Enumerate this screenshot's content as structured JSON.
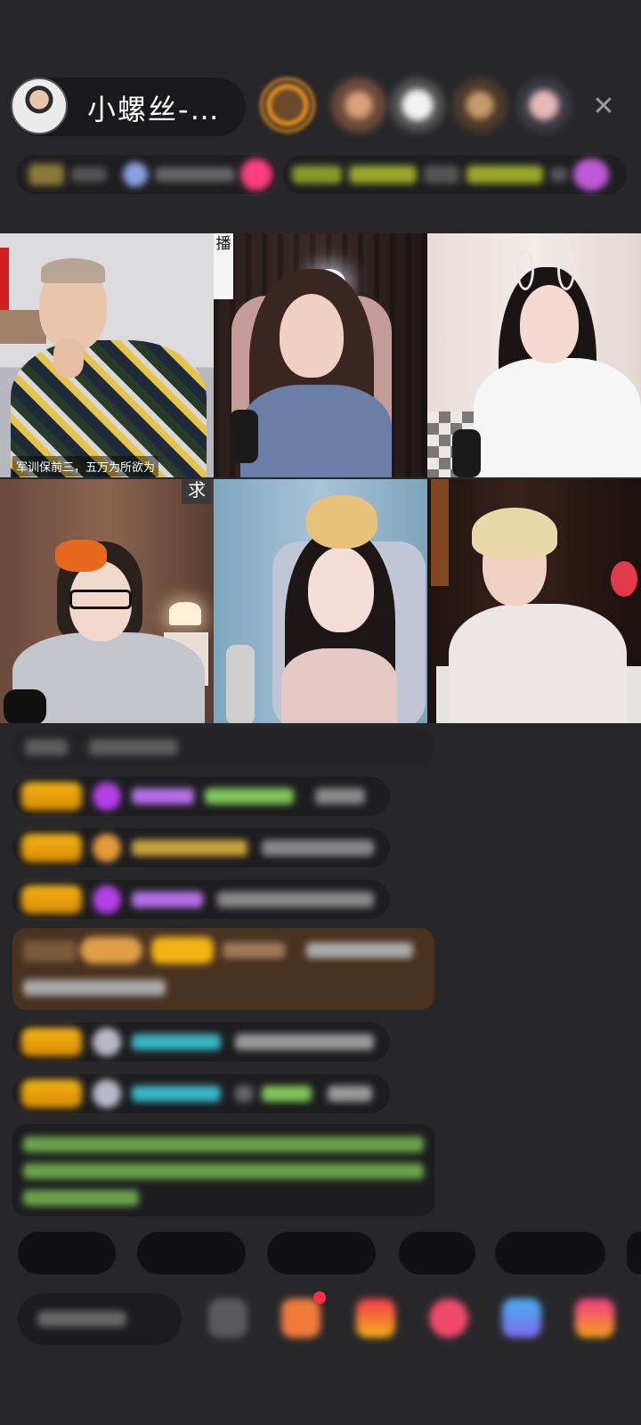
{
  "host": {
    "name": "小螺丝-…"
  },
  "header": {
    "close_icon": "close-icon",
    "viewer_count": 5
  },
  "streams": [
    {
      "overlay_text": "军训保前三，五万为所欲为",
      "corner_tag": "播"
    },
    {
      "overlay_text": "",
      "corner_tag": ""
    },
    {
      "overlay_text": "",
      "corner_tag": ""
    },
    {
      "overlay_text": "",
      "corner_tag": "求"
    },
    {
      "overlay_text": "",
      "corner_tag": ""
    },
    {
      "overlay_text": "",
      "corner_tag": ""
    }
  ],
  "colors": {
    "background": "#27272a",
    "badge": "#f3b413",
    "accent_pink": "#ff3d7f",
    "chat_green": "#7fc45a",
    "chat_cyan": "#39b6c4",
    "chat_purple": "#b46fe8"
  }
}
